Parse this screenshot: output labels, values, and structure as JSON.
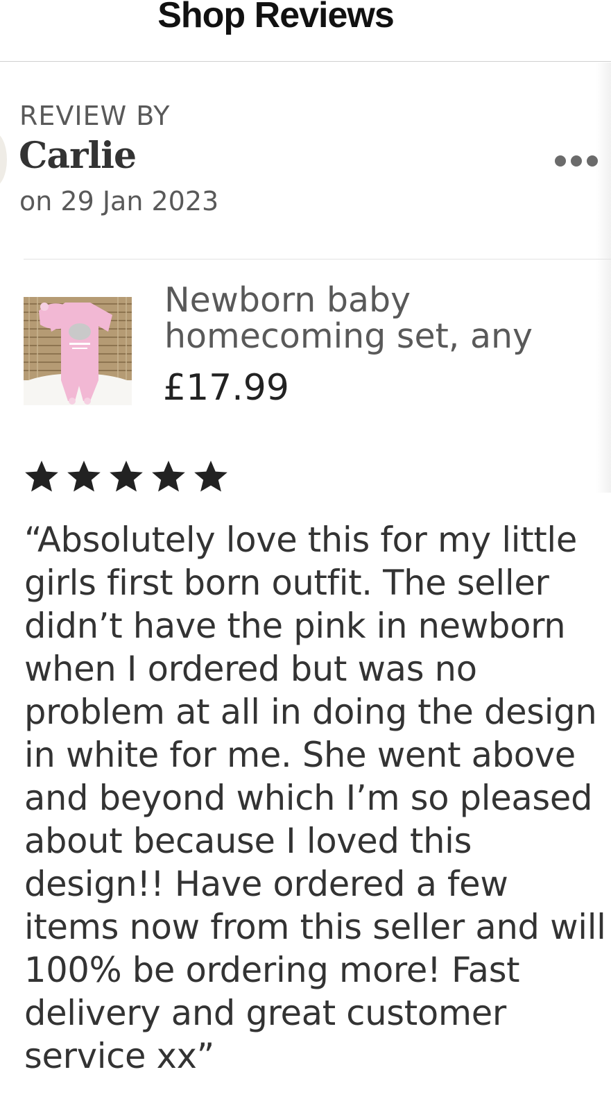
{
  "header": {
    "title": "Shop Reviews"
  },
  "review": {
    "by_label": "REVIEW BY",
    "reviewer": "Carlie",
    "date": "on 29 Jan 2023",
    "more_icon": "more-dots-icon",
    "product": {
      "title": "Newborn baby homecoming set, any",
      "price": "£17.99"
    },
    "rating": 5,
    "rating_max": 5,
    "text": "“Absolutely love this for my little girls first born outfit. The seller didn’t have the pink in newborn when I ordered but was no problem at all in doing the design in white for me. She went above and beyond which I’m so pleased about because I loved this design!! Have ordered a few items now from this seller and will 100% be ordering more! Fast delivery and great customer service xx”"
  },
  "colors": {
    "text_dark": "#222222",
    "text_muted": "#595959",
    "star": "#222222",
    "product_pink": "#f2b8d4"
  }
}
